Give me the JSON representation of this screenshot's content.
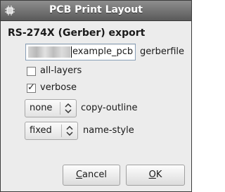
{
  "window": {
    "title": "PCB Print Layout"
  },
  "section": {
    "heading": "RS-274X (Gerber) export"
  },
  "gerberfile": {
    "value": "example_pcb",
    "label": "gerberfile"
  },
  "options": {
    "all_layers": {
      "label": "all-layers",
      "checked": false
    },
    "verbose": {
      "label": "verbose",
      "checked": true
    }
  },
  "copy_outline": {
    "selected": "none",
    "label": "copy-outline"
  },
  "name_style": {
    "selected": "fixed",
    "label": "name-style"
  },
  "buttons": {
    "cancel": {
      "mnemonic": "C",
      "rest": "ancel"
    },
    "ok": {
      "mnemonic": "O",
      "rest": "K"
    }
  },
  "icons": {
    "title_icon": "pcb-chip-icon",
    "check": "✓",
    "combo_arrow": "up-down-arrows-icon"
  },
  "colors": {
    "titlebar": "#5a5a5a",
    "window_bg": "#ececec",
    "input_border": "#8aa0b8"
  }
}
